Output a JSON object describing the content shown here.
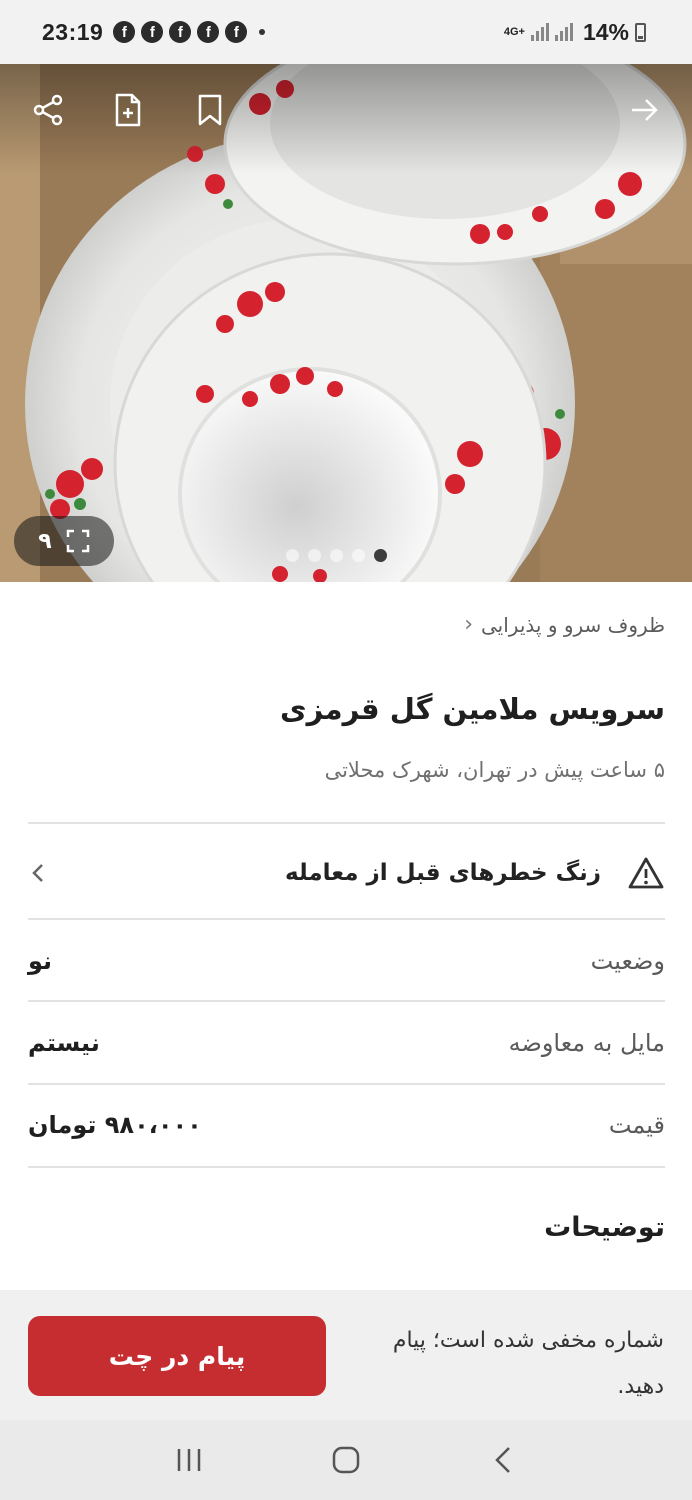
{
  "status_bar": {
    "time": "23:19",
    "notification_icons": [
      "f",
      "f",
      "f",
      "f",
      "f"
    ],
    "network": "4G+",
    "battery": "14%"
  },
  "gallery": {
    "image_count": "۹",
    "dots_total": 5,
    "dot_active": 5
  },
  "breadcrumb": {
    "category": "ظروف سرو و پذیرایی"
  },
  "listing": {
    "title": "سرویس ملامین گل قرمزی",
    "posted": "۵ ساعت پیش در تهران، شهرک محلاتی"
  },
  "warning": {
    "label": "زنگ خطرهای قبل از معامله"
  },
  "details": [
    {
      "label": "وضعیت",
      "value": "نو"
    },
    {
      "label": "مایل به معاوضه",
      "value": "نیستم"
    },
    {
      "label": "قیمت",
      "value": "۹۸۰،۰۰۰ تومان"
    }
  ],
  "description": {
    "title": "توضیحات"
  },
  "action": {
    "note": "شماره مخفی شده است؛ پیام دهید.",
    "chat_button": "پیام در چت"
  },
  "colors": {
    "accent": "#c62d31",
    "rose": "#d4232f"
  }
}
